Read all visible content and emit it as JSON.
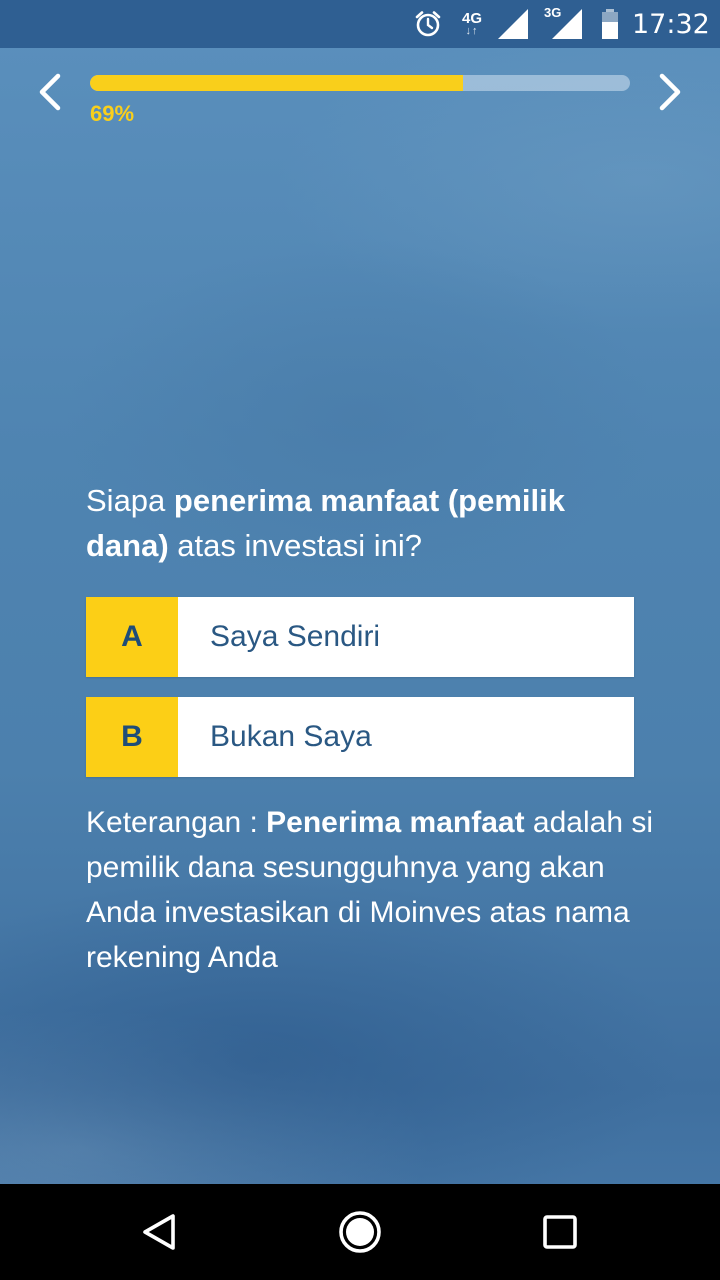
{
  "status_bar": {
    "network_1": "4G",
    "network_1_arrows": "↓↑",
    "network_2": "3G",
    "time": "17:32",
    "icons": [
      "alarm-icon",
      "signal-icon",
      "signal-icon",
      "battery-icon"
    ]
  },
  "progress": {
    "value": 0.69,
    "label": "69%"
  },
  "question": {
    "prefix": "Siapa ",
    "bold": "penerima manfaat (pemilik dana)",
    "suffix": " atas investasi ini?"
  },
  "options": [
    {
      "letter": "A",
      "label": "Saya Sendiri"
    },
    {
      "letter": "B",
      "label": "Bukan Saya"
    }
  ],
  "note": {
    "prefix": "Keterangan : ",
    "bold": "Penerima manfaat",
    "suffix": " adalah si pemilik dana sesungguhnya yang akan Anda investasikan di Moinves atas nama rekening Anda"
  },
  "colors": {
    "accent_yellow": "#f9cf1b",
    "background_blue": "#4f82ad",
    "status_bar": "#2f5f92",
    "option_text": "#2a5883"
  }
}
